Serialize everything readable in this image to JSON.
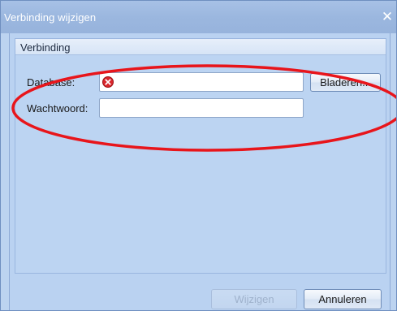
{
  "window": {
    "title": "Verbinding wijzigen",
    "close_icon": "close-icon"
  },
  "group": {
    "title": "Verbinding"
  },
  "fields": {
    "database": {
      "label": "Database:",
      "value": "",
      "error_icon": "error-circle-icon",
      "browse_label": "Bladeren..."
    },
    "password": {
      "label": "Wachtwoord:",
      "value": ""
    }
  },
  "buttons": {
    "ok_label": "Wijzigen",
    "cancel_label": "Annuleren"
  },
  "colors": {
    "title_bar": "#9bb7df",
    "client": "#bad2f1",
    "annotation_ellipse": "#e8151b",
    "error_icon": "#d9262c"
  }
}
